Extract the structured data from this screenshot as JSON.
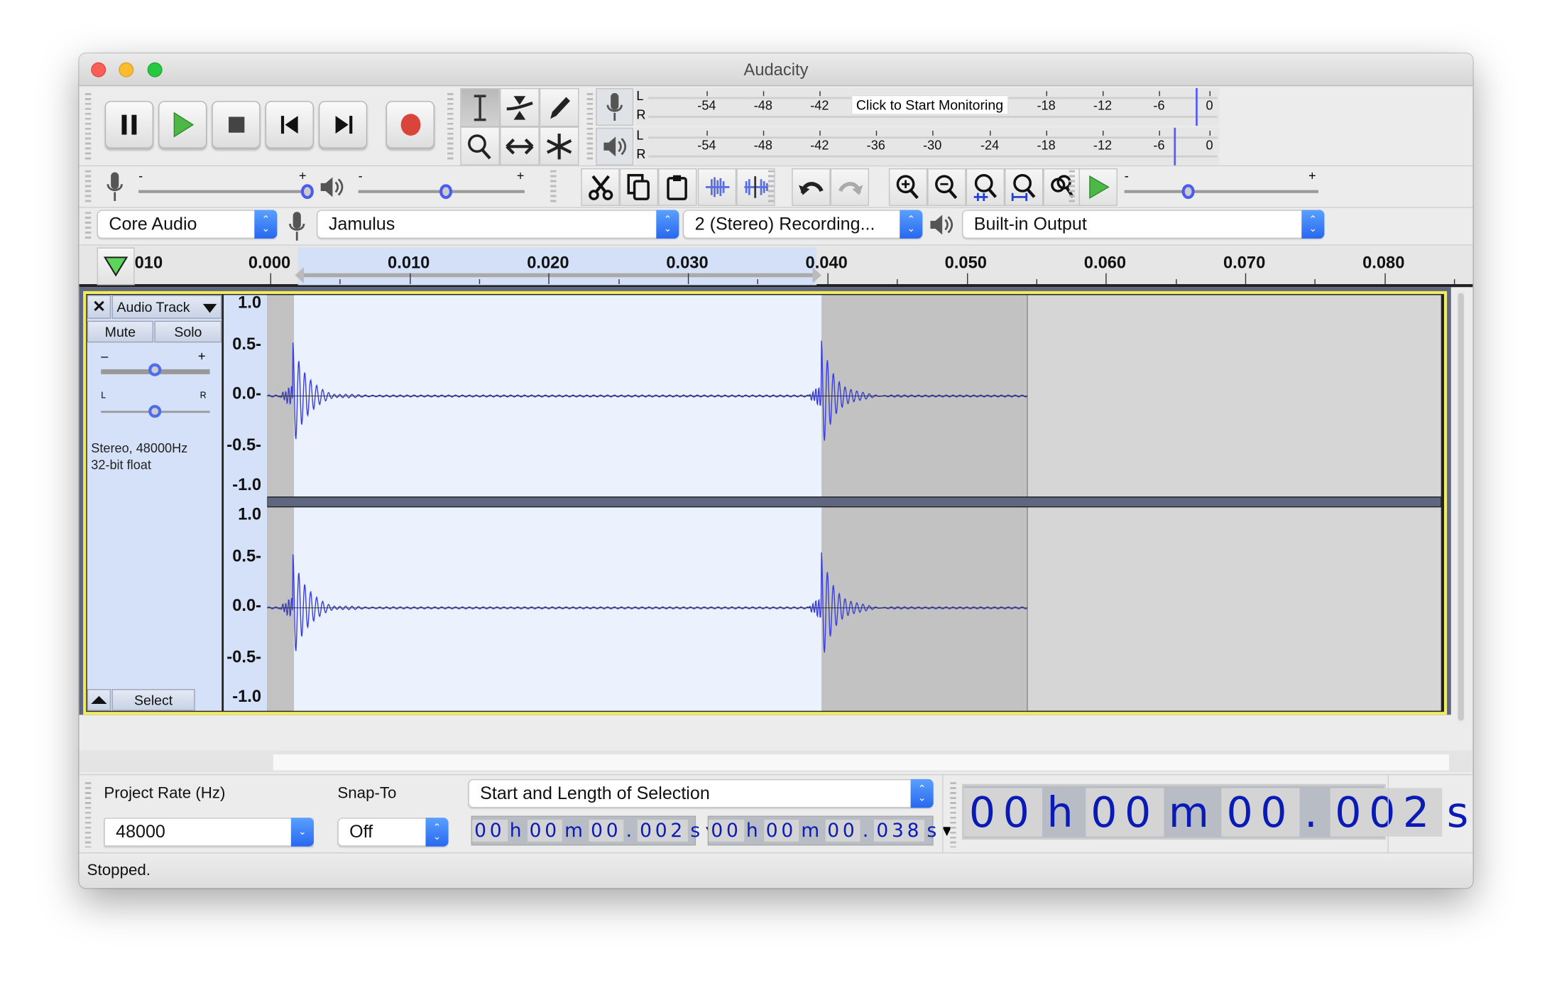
{
  "window": {
    "title": "Audacity"
  },
  "transport": {
    "buttons": [
      "pause",
      "play",
      "stop",
      "skip-to-start",
      "skip-to-end",
      "record"
    ]
  },
  "tools": [
    "selection",
    "envelope",
    "draw",
    "zoom",
    "time-shift",
    "multi"
  ],
  "meters": {
    "record": {
      "channels": [
        "L",
        "R"
      ],
      "ticks": [
        "-54",
        "-48",
        "-42",
        "-18",
        "-12",
        "-6",
        "0"
      ],
      "monitor_label": "Click to Start Monitoring"
    },
    "playback": {
      "channels": [
        "L",
        "R"
      ],
      "ticks": [
        "-54",
        "-48",
        "-42",
        "-36",
        "-30",
        "-24",
        "-18",
        "-12",
        "-6",
        "0"
      ]
    }
  },
  "mixer": {
    "minus": "-",
    "plus": "+",
    "record_volume": 1.0,
    "playback_volume": 0.5
  },
  "play_at_speed": {
    "minus": "-",
    "plus": "+",
    "speed": 0.33
  },
  "devices": {
    "host": "Core Audio",
    "input": "Jamulus",
    "channels": "2 (Stereo) Recording...",
    "output": "Built-in Output"
  },
  "ruler": {
    "labels": [
      "010",
      "0.000",
      "0.010",
      "0.020",
      "0.030",
      "0.040",
      "0.050",
      "0.060",
      "0.070",
      "0.080"
    ]
  },
  "track": {
    "name": "Audio Track",
    "mute": "Mute",
    "solo": "Solo",
    "gain_minus": "–",
    "gain_plus": "+",
    "pan_left": "L",
    "pan_right": "R",
    "gain": 0.5,
    "pan": 0.5,
    "info1": "Stereo, 48000Hz",
    "info2": "32-bit float",
    "select": "Select",
    "scale": [
      "1.0",
      "0.5-",
      "0.0-",
      "-0.5-",
      "-1.0"
    ],
    "waveform_color": "#3a3fd9"
  },
  "selection_bar": {
    "rate_label": "Project Rate (Hz)",
    "rate_value": "48000",
    "snap_label": "Snap-To",
    "snap_value": "Off",
    "format": "Start and Length of Selection",
    "start": {
      "h": "00",
      "hu": "h",
      "m": "00",
      "mu": "m",
      "s": "00",
      "dot": ".",
      "ms": "002",
      "su": "s"
    },
    "length": {
      "h": "00",
      "hu": "h",
      "m": "00",
      "mu": "m",
      "s": "00",
      "dot": ".",
      "ms": "038",
      "su": "s"
    }
  },
  "audio_position": {
    "h": "00",
    "hu": "h",
    "m": "00",
    "mu": "m",
    "s": "00",
    "dot": ".",
    "ms": "002",
    "su": "s"
  },
  "status": "Stopped."
}
